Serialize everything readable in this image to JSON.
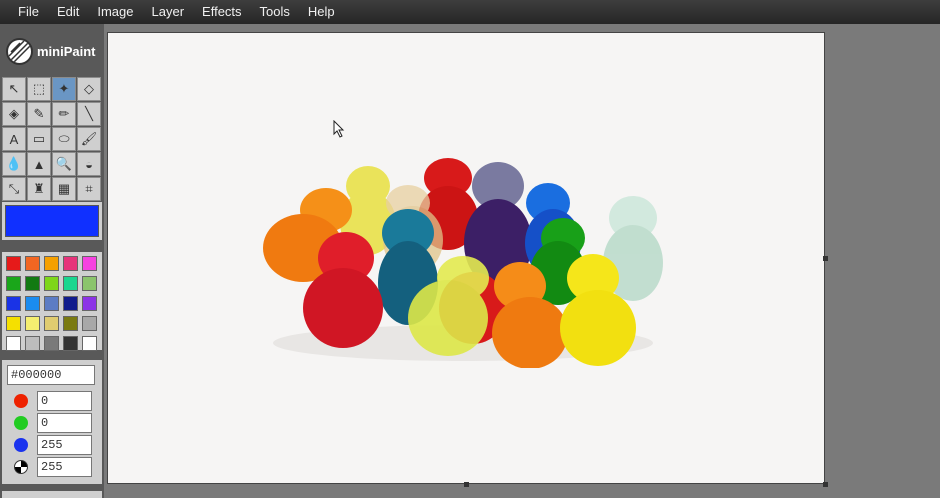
{
  "app": {
    "name": "miniPaint"
  },
  "menu": [
    "File",
    "Edit",
    "Image",
    "Layer",
    "Effects",
    "Tools",
    "Help"
  ],
  "tools": [
    {
      "name": "select-icon",
      "glyph": "↖"
    },
    {
      "name": "rect-select-icon",
      "glyph": "⬚"
    },
    {
      "name": "magic-wand-icon",
      "glyph": "✦",
      "active": true
    },
    {
      "name": "eraser-icon",
      "glyph": "◇"
    },
    {
      "name": "fill-bucket-icon",
      "glyph": "◈"
    },
    {
      "name": "eyedropper-icon",
      "glyph": "✎"
    },
    {
      "name": "pencil-icon",
      "glyph": "✏"
    },
    {
      "name": "line-icon",
      "glyph": "╲"
    },
    {
      "name": "text-icon",
      "glyph": "A"
    },
    {
      "name": "rectangle-icon",
      "glyph": "▭"
    },
    {
      "name": "ellipse-icon",
      "glyph": "⬭"
    },
    {
      "name": "brush-icon",
      "glyph": "🖌"
    },
    {
      "name": "blur-icon",
      "glyph": "💧"
    },
    {
      "name": "sharpen-icon",
      "glyph": "▲"
    },
    {
      "name": "zoom-icon",
      "glyph": "🔍"
    },
    {
      "name": "desaturate-icon",
      "glyph": "◒"
    },
    {
      "name": "bulge-icon",
      "glyph": "⤡"
    },
    {
      "name": "clone-icon",
      "glyph": "♜"
    },
    {
      "name": "gradient-icon",
      "glyph": "▦"
    },
    {
      "name": "crop-icon",
      "glyph": "⌗"
    }
  ],
  "current_color": "#1030ff",
  "palette": [
    "#e61a1a",
    "#f26622",
    "#f5a000",
    "#e6337a",
    "#f542e0",
    "#1aa61a",
    "#127a12",
    "#7ed61a",
    "#1ad68f",
    "#8bc46c",
    "#1a33e6",
    "#1a8cf0",
    "#5c7cc4",
    "#101c8c",
    "#8c33e6",
    "#f5e000",
    "#f5ee70",
    "#e0cc70",
    "#7a7a10",
    "#a8a8a8",
    "#ffffff",
    "#bdbdbd",
    "#7a7a7a",
    "#333333",
    "#ffffff"
  ],
  "color_picker": {
    "hex": "#000000",
    "red": "0",
    "green": "0",
    "blue": "255",
    "alpha": "255",
    "red_color": "#ee2200",
    "green_color": "#22cc22",
    "blue_color": "#1a33ee"
  }
}
